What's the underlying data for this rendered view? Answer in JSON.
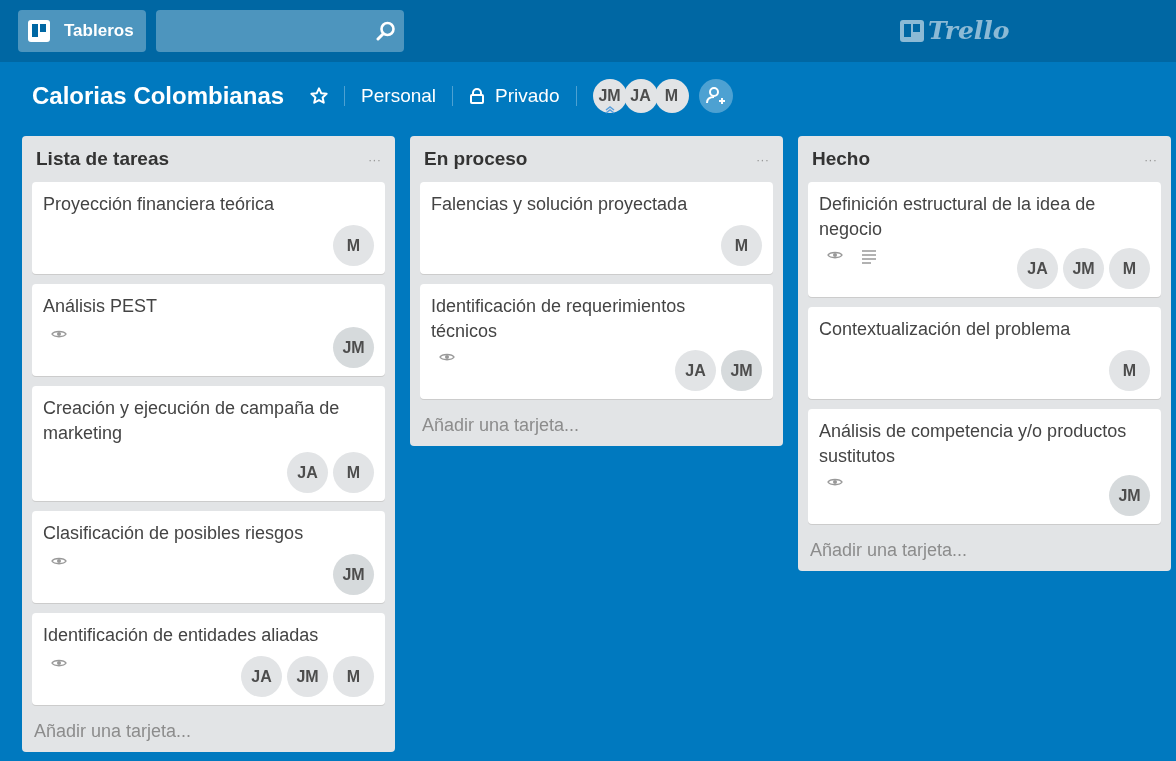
{
  "header": {
    "boards_button": "Tableros",
    "logo": "Trello"
  },
  "board": {
    "title": "Calorias Colombianas",
    "starred": false,
    "team": "Personal",
    "visibility": "Privado",
    "members": [
      {
        "initials": "JM",
        "admin": true
      },
      {
        "initials": "JA",
        "admin": false
      },
      {
        "initials": "M",
        "admin": false
      }
    ]
  },
  "lists": [
    {
      "title": "Lista de tareas",
      "menu": "···",
      "add_card": "Añadir una tarjeta...",
      "cards": [
        {
          "title": "Proyección financiera teórica",
          "watching": false,
          "has_description": false,
          "members": [
            "M"
          ]
        },
        {
          "title": "Análisis PEST",
          "watching": true,
          "has_description": false,
          "members": [
            "JM"
          ]
        },
        {
          "title": "Creación y ejecución de campaña de marketing",
          "watching": false,
          "has_description": false,
          "members": [
            "JA",
            "M"
          ]
        },
        {
          "title": "Clasificación de posibles riesgos",
          "watching": true,
          "has_description": false,
          "members": [
            "JM"
          ]
        },
        {
          "title": "Identificación de entidades aliadas",
          "watching": true,
          "has_description": false,
          "members": [
            "JA",
            "JM",
            "M"
          ]
        }
      ]
    },
    {
      "title": "En proceso",
      "menu": "···",
      "add_card": "Añadir una tarjeta...",
      "cards": [
        {
          "title": "Falencias y solución proyectada",
          "watching": false,
          "has_description": false,
          "members": [
            "M"
          ]
        },
        {
          "title": "Identificación de requerimientos técnicos",
          "watching": true,
          "has_description": false,
          "members": [
            "JA",
            "JM"
          ]
        }
      ]
    },
    {
      "title": "Hecho",
      "menu": "···",
      "add_card": "Añadir una tarjeta...",
      "cards": [
        {
          "title": "Definición estructural de la idea de negocio",
          "watching": true,
          "has_description": true,
          "members": [
            "JA",
            "JM",
            "M"
          ]
        },
        {
          "title": "Contextualización del problema",
          "watching": false,
          "has_description": false,
          "members": [
            "M"
          ]
        },
        {
          "title": "Análisis de competencia y/o productos sustitutos",
          "watching": true,
          "has_description": false,
          "members": [
            "JM"
          ]
        }
      ]
    }
  ]
}
